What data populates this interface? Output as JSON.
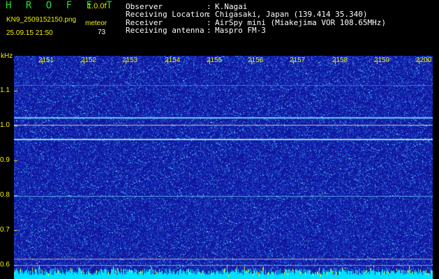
{
  "header": {
    "app_title": "H R O F F T",
    "version": "1.0.0f",
    "filename": "KN9_2509152150.png",
    "timestamp": "25.09.15 21:50",
    "meteor_label": "meteor",
    "meteor_count": "73"
  },
  "info": [
    {
      "label": "Observer",
      "value": "K.Nagai"
    },
    {
      "label": "Receiving Location",
      "value": "Chigasaki, Japan (139.414 35.340)"
    },
    {
      "label": "Receiver",
      "value": "AirSpy mini (Miakejima VOR 108.65MHz)"
    },
    {
      "label": "Receiving antenna",
      "value": "Maspro FM-3"
    }
  ],
  "spectrogram": {
    "y_unit": "kHz",
    "y_ticks": [
      "1.1",
      "1.0",
      "0.9",
      "0.8",
      "0.7",
      "0.6"
    ],
    "x_ticks": [
      "2151",
      "2152",
      "2153",
      "2154",
      "2155",
      "2156",
      "2157",
      "2158",
      "2159",
      "2200"
    ],
    "colors": {
      "background": "#10109a",
      "noise_bright": "#4fd8ff",
      "reference_line": "#d8d8b0",
      "tick_label": "#f0f000",
      "bottom_band": "#00e0ff"
    }
  }
}
